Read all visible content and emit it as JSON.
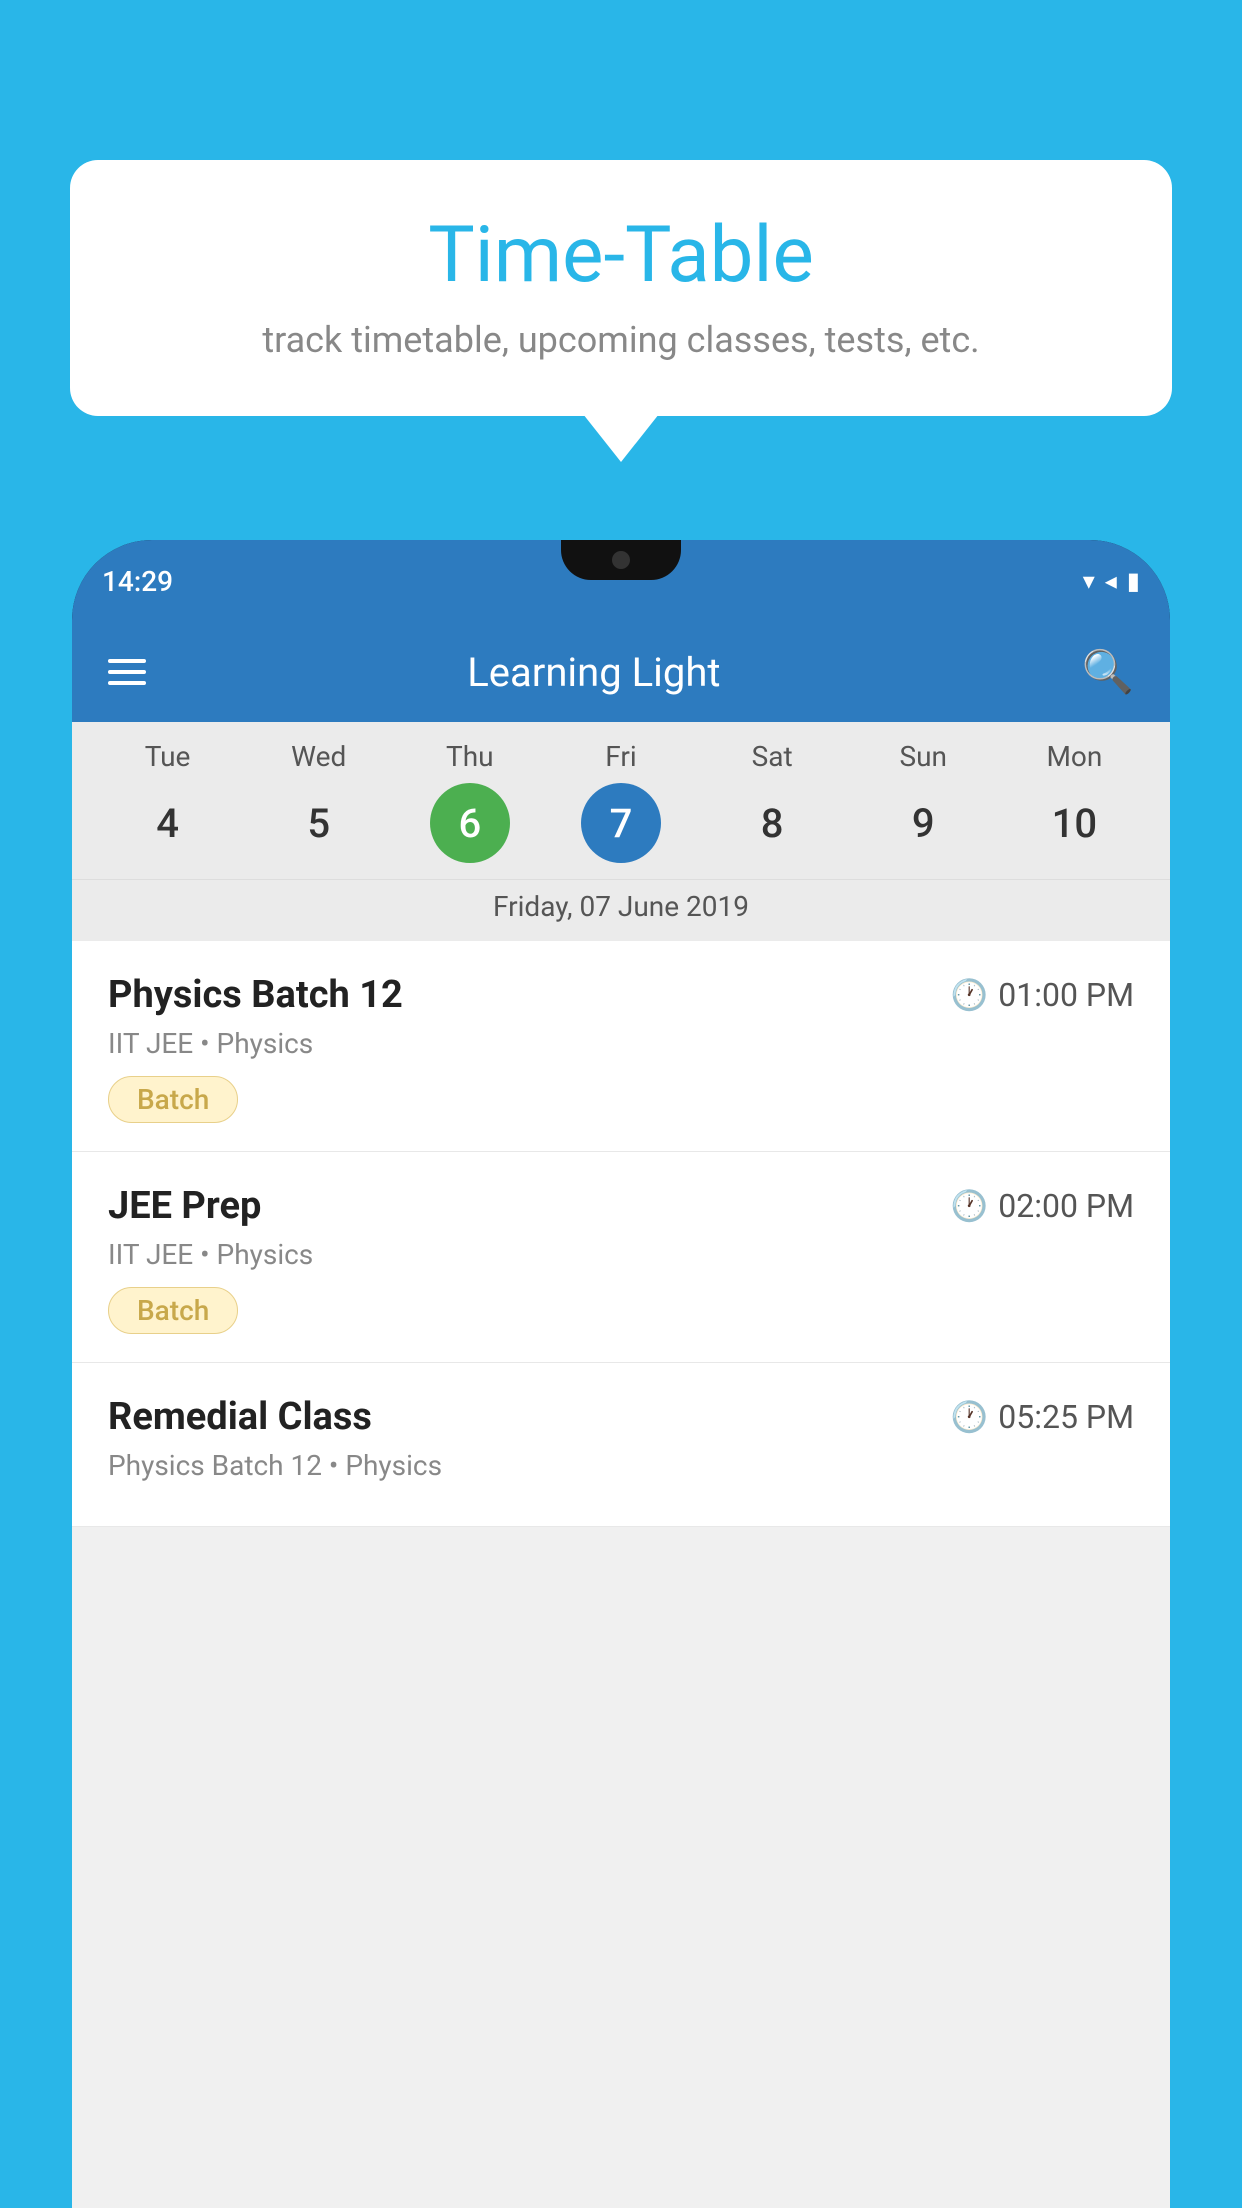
{
  "background_color": "#29b6e8",
  "bubble": {
    "title": "Time-Table",
    "subtitle": "track timetable, upcoming classes, tests, etc."
  },
  "phone": {
    "status_time": "14:29",
    "app_title": "Learning Light",
    "calendar": {
      "days": [
        {
          "label": "Tue",
          "num": "4"
        },
        {
          "label": "Wed",
          "num": "5"
        },
        {
          "label": "Thu",
          "num": "6",
          "state": "today"
        },
        {
          "label": "Fri",
          "num": "7",
          "state": "selected"
        },
        {
          "label": "Sat",
          "num": "8"
        },
        {
          "label": "Sun",
          "num": "9"
        },
        {
          "label": "Mon",
          "num": "10"
        }
      ],
      "selected_date_label": "Friday, 07 June 2019"
    },
    "classes": [
      {
        "name": "Physics Batch 12",
        "time": "01:00 PM",
        "subject": "IIT JEE • Physics",
        "badge": "Batch"
      },
      {
        "name": "JEE Prep",
        "time": "02:00 PM",
        "subject": "IIT JEE • Physics",
        "badge": "Batch"
      },
      {
        "name": "Remedial Class",
        "time": "05:25 PM",
        "subject": "Physics Batch 12 • Physics",
        "badge": ""
      }
    ]
  }
}
